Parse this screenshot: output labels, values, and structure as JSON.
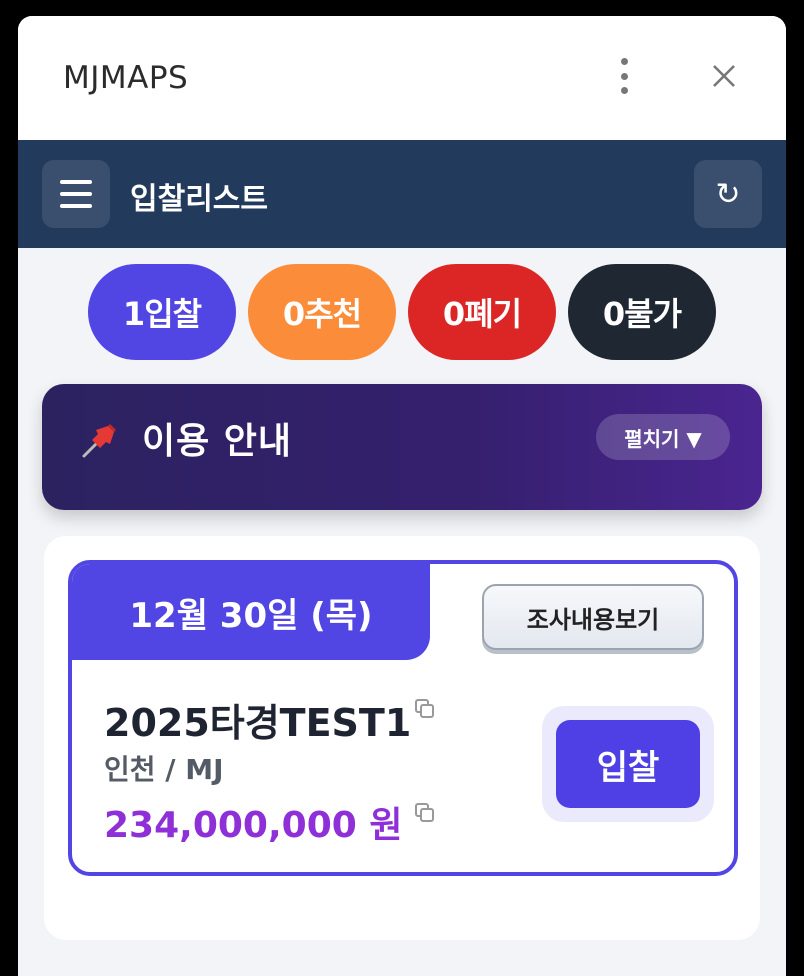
{
  "app": {
    "title": "MJMAPS"
  },
  "toolbar": {
    "title": "입찰리스트",
    "refresh_glyph": "↻"
  },
  "counts": [
    {
      "label": "1입찰",
      "color": "#5145e4"
    },
    {
      "label": "0추천",
      "color": "#fb8c3a"
    },
    {
      "label": "0폐기",
      "color": "#dc2626"
    },
    {
      "label": "0불가",
      "color": "#1f2733"
    }
  ],
  "notice": {
    "title": "이용 안내",
    "expand_label": "펼치기 ▼",
    "icon": "pushpin-icon"
  },
  "card": {
    "date": "12월 30일 (목)",
    "survey_label": "조사내용보기",
    "name": "2025타경TEST1",
    "region": "인천 / MJ",
    "price": "234,000,000 원",
    "bid_label": "입찰"
  },
  "colors": {
    "accent": "#5145e4",
    "toolbar": "#223a5c",
    "price": "#8e2fd8"
  }
}
